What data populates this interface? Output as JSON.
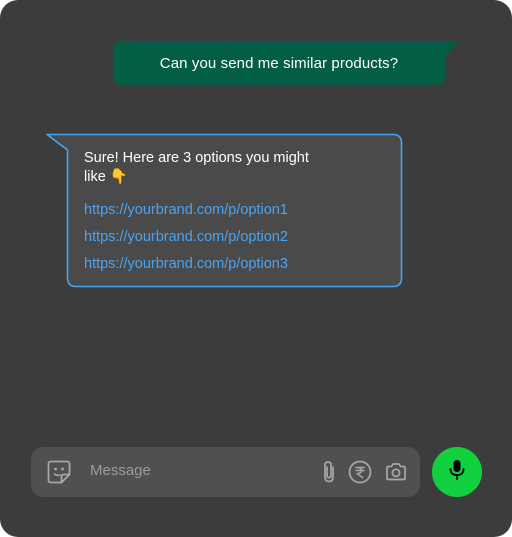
{
  "colors": {
    "background": "#3c3c3c",
    "outgoing_bubble": "#045d45",
    "incoming_border": "#4aa3f0",
    "link": "#4aa3f0",
    "mic_button": "#12d13e"
  },
  "messages": {
    "outgoing": {
      "text": "Can you send me similar products?"
    },
    "incoming": {
      "text_line1": "Sure! Here are 3 options you might",
      "text_line2": "like 👇",
      "links": [
        "https://yourbrand.com/p/option1",
        "https://yourbrand.com/p/option2",
        "https://yourbrand.com/p/option3"
      ]
    }
  },
  "composer": {
    "placeholder": "Message",
    "icons": [
      "sticker-icon",
      "paperclip-icon",
      "rupee-icon",
      "camera-icon",
      "microphone-icon"
    ]
  }
}
